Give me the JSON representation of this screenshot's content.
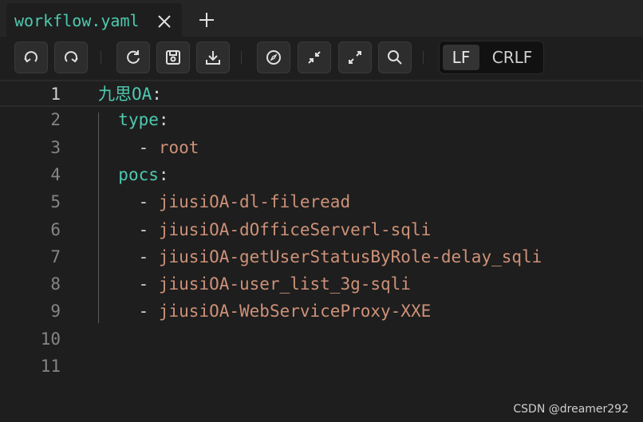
{
  "tab": {
    "title": "workflow.yaml"
  },
  "toolbar": {
    "buttons": [
      {
        "icon": "undo-icon"
      },
      {
        "icon": "redo-icon"
      },
      {
        "icon": "refresh-icon"
      },
      {
        "icon": "save-icon"
      },
      {
        "icon": "download-icon"
      },
      {
        "icon": "compass-icon"
      },
      {
        "icon": "collapse-icon"
      },
      {
        "icon": "expand-icon"
      },
      {
        "icon": "search-icon"
      }
    ],
    "eol": {
      "lf": "LF",
      "crlf": "CRLF",
      "selected": "LF"
    }
  },
  "editor": {
    "lines": [
      {
        "num": "1",
        "indent": "",
        "dash": "",
        "key": "九思OA",
        "colon": ":",
        "value": ""
      },
      {
        "num": "2",
        "indent": "  ",
        "dash": "",
        "key": "type",
        "colon": ":",
        "value": ""
      },
      {
        "num": "3",
        "indent": "    ",
        "dash": "- ",
        "key": "",
        "colon": "",
        "value": "root"
      },
      {
        "num": "4",
        "indent": "  ",
        "dash": "",
        "key": "pocs",
        "colon": ":",
        "value": ""
      },
      {
        "num": "5",
        "indent": "    ",
        "dash": "- ",
        "key": "",
        "colon": "",
        "value": "jiusiOA-dl-fileread"
      },
      {
        "num": "6",
        "indent": "    ",
        "dash": "- ",
        "key": "",
        "colon": "",
        "value": "jiusiOA-dOfficeServerl-sqli"
      },
      {
        "num": "7",
        "indent": "    ",
        "dash": "- ",
        "key": "",
        "colon": "",
        "value": "jiusiOA-getUserStatusByRole-delay_sqli"
      },
      {
        "num": "8",
        "indent": "    ",
        "dash": "- ",
        "key": "",
        "colon": "",
        "value": "jiusiOA-user_list_3g-sqli"
      },
      {
        "num": "9",
        "indent": "    ",
        "dash": "- ",
        "key": "",
        "colon": "",
        "value": "jiusiOA-WebServiceProxy-XXE"
      },
      {
        "num": "10",
        "indent": "",
        "dash": "",
        "key": "",
        "colon": "",
        "value": ""
      },
      {
        "num": "11",
        "indent": "",
        "dash": "",
        "key": "",
        "colon": "",
        "value": ""
      }
    ],
    "active_line": "1"
  },
  "watermark": "CSDN @dreamer292",
  "colors": {
    "key": "#4ec9b0",
    "value": "#ce9178",
    "background": "#1e1e1e"
  }
}
